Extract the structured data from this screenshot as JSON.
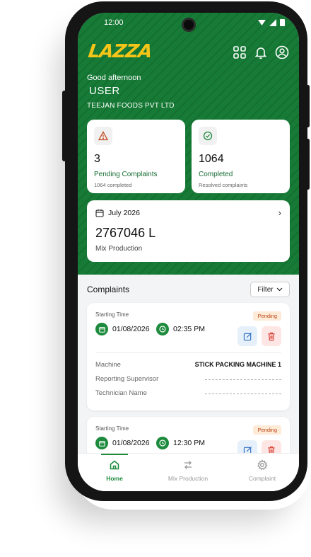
{
  "status_bar": {
    "time": "12:00",
    "icons": "▼◢▮"
  },
  "app": {
    "logo": "LAZZA"
  },
  "header": {
    "greeting": "Good afternoon",
    "user": "USER",
    "company": "TEEJAN FOODS PVT LTD"
  },
  "stats": {
    "pending": {
      "count": "3",
      "label": "Pending Complaints",
      "sub": "1064 completed"
    },
    "completed": {
      "count": "1064",
      "label": "Completed",
      "sub": "Resolved complaints"
    }
  },
  "mix_card": {
    "month": "July 2026",
    "value": "2767046 L",
    "label": "Mix Production"
  },
  "complaints": {
    "title": "Complaints",
    "filter_label": "Filter",
    "items": [
      {
        "start_label": "Starting Time",
        "status": "Pending",
        "date": "01/08/2026",
        "time": "02:35 PM",
        "machine_label": "Machine",
        "machine": "STICK PACKING MACHINE 1",
        "supervisor_label": "Reporting Supervisor",
        "technician_label": "Technician Name"
      },
      {
        "start_label": "Starting Time",
        "status": "Pending",
        "date": "01/08/2026",
        "time": "12:30 PM"
      }
    ]
  },
  "nav": {
    "home": "Home",
    "mix": "Mix Production",
    "complaint": "Complaint"
  },
  "colors": {
    "primary": "#177b37",
    "accent": "#f5c518",
    "pending": "#c0481a"
  }
}
